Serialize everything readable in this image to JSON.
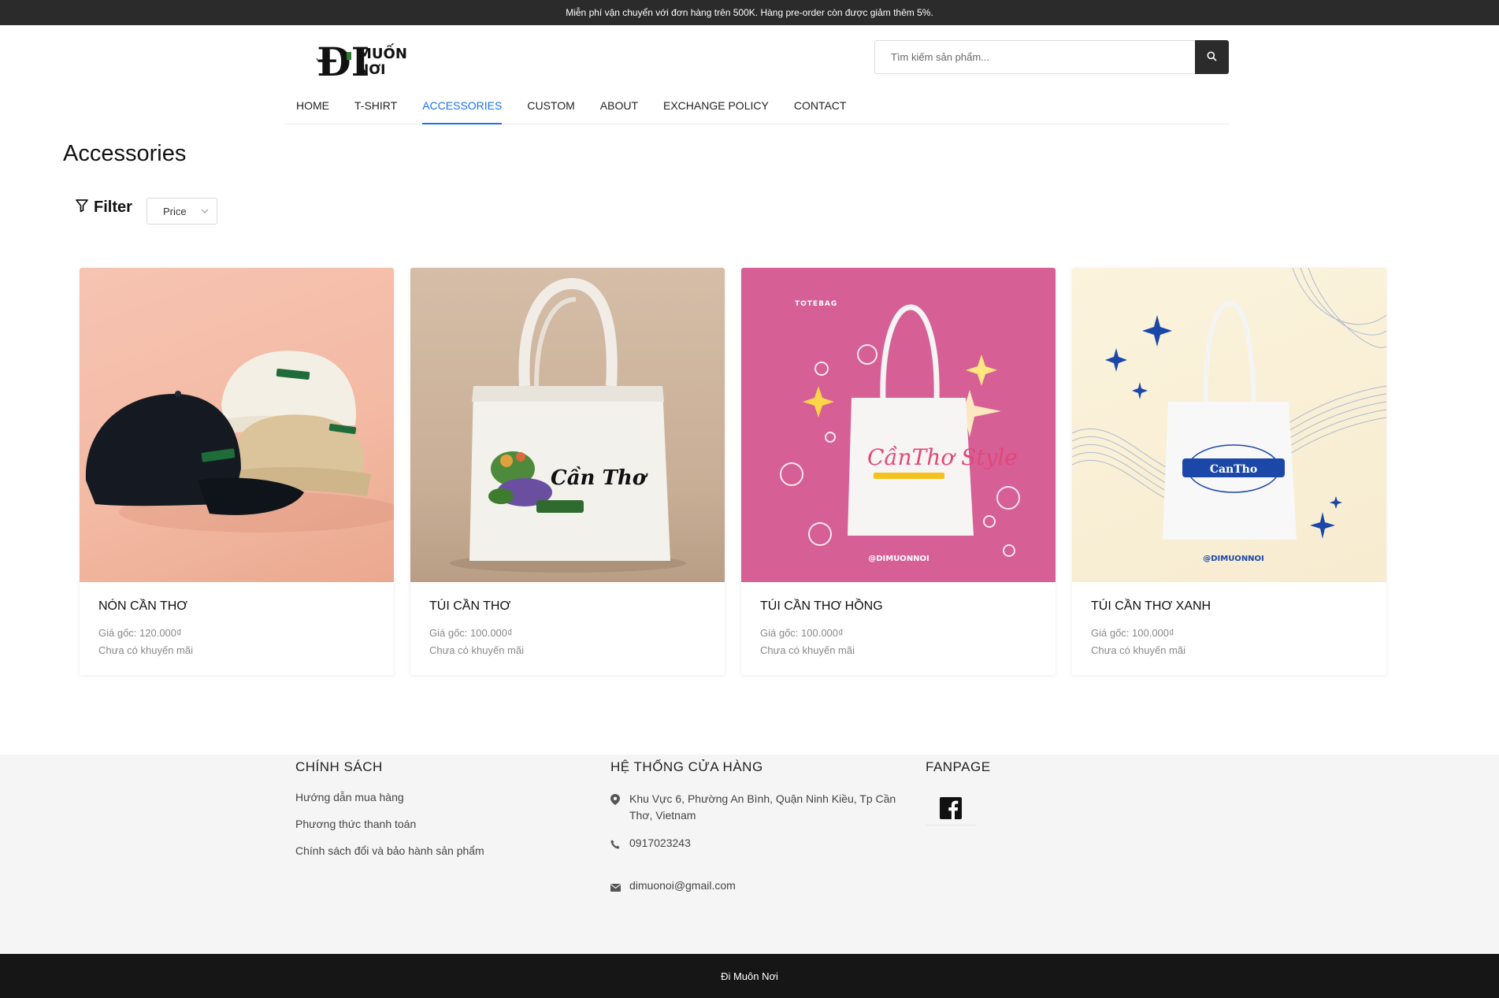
{
  "announcement": "Miễn phí vận chuyển với đơn hàng trên 500K. Hàng pre-order còn được giảm thêm 5%.",
  "brand": {
    "logo_primary": "ĐI",
    "logo_secondary": "MUỐN",
    "logo_tertiary": "NƠI"
  },
  "search": {
    "placeholder": "Tìm kiếm sản phẩm..."
  },
  "nav": [
    {
      "label": "HOME",
      "active": false
    },
    {
      "label": "T-SHIRT",
      "active": false
    },
    {
      "label": "ACCESSORIES",
      "active": true
    },
    {
      "label": "CUSTOM",
      "active": false
    },
    {
      "label": "ABOUT",
      "active": false
    },
    {
      "label": "EXCHANGE POLICY",
      "active": false
    },
    {
      "label": "CONTACT",
      "active": false
    }
  ],
  "page": {
    "title": "Accessories"
  },
  "filter": {
    "label": "Filter",
    "price_select": "Price"
  },
  "products": [
    {
      "name": "NÓN CẦN THƠ",
      "price": "Giá gốc: 120.000₫",
      "promo": "Chưa có khuyến mãi"
    },
    {
      "name": "TÚI CẦN THƠ",
      "price": "Giá gốc: 100.000₫",
      "promo": "Chưa có khuyến mãi",
      "print": "Cần Thơ"
    },
    {
      "name": "TÚI CẦN THƠ HỒNG",
      "price": "Giá gốc: 100.000₫",
      "promo": "Chưa có khuyến mãi",
      "tag": "TOTEBAG",
      "print": "CầnThơ Style",
      "handle": "@DIMUONNOI"
    },
    {
      "name": "TÚI CẦN THƠ XANH",
      "price": "Giá gốc: 100.000₫",
      "promo": "Chưa có khuyến mãi",
      "print": "CanTho",
      "handle": "@DIMUONNOI"
    }
  ],
  "footer": {
    "policy": {
      "heading": "CHÍNH SÁCH",
      "links": [
        "Hướng dẫn mua hàng",
        "Phương thức thanh toán",
        "Chính sách đổi và bảo hành sản phẩm"
      ]
    },
    "stores": {
      "heading": "HỆ THỐNG CỬA HÀNG",
      "address": "Khu Vực 6, Phường An Bình, Quận Ninh Kiều, Tp Cần Thơ, Vietnam",
      "phone": "0917023243",
      "email": "dimuonoi@gmail.com"
    },
    "fanpage": {
      "heading": "FANPAGE"
    }
  },
  "copyright": "Đi Muôn Nơi",
  "colors": {
    "accent": "#1a73e8",
    "dark": "#2b2b2b",
    "footer_bg": "#f5f5f5",
    "bottom_bar": "#161616"
  }
}
